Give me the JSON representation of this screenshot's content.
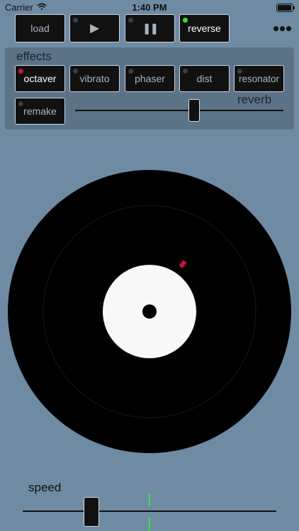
{
  "status": {
    "carrier": "Carrier",
    "time": "1:40 PM"
  },
  "toolbar": {
    "load_label": "load",
    "play_glyph": "▶",
    "pause_glyph": "❚❚",
    "reverse_label": "reverse",
    "more_icon": "more-dots-icon"
  },
  "effects": {
    "title": "effects",
    "octaver_label": "octaver",
    "vibrato_label": "vibrato",
    "phaser_label": "phaser",
    "dist_label": "dist",
    "resonator_label": "resonator",
    "remake_label": "remake",
    "reverb_label": "reverb",
    "reverb_value": 0.57
  },
  "speed": {
    "label": "speed",
    "value": 0.27
  },
  "colors": {
    "background": "#6f8ba3",
    "panel": "#5c7387",
    "led_on_red": "#c8143c",
    "led_on_green": "#34e02c",
    "accent_green": "#38e83a",
    "record_label": "#f8f8f8",
    "marker": "#c8143c"
  }
}
